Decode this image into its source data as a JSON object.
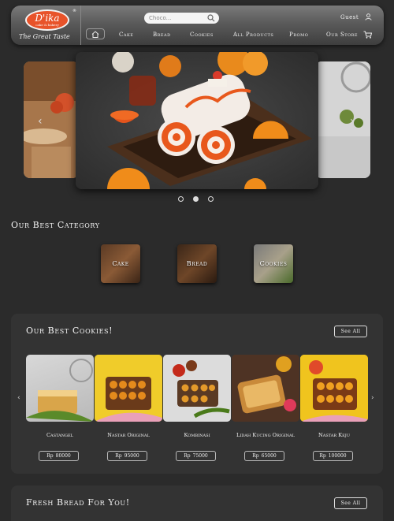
{
  "header": {
    "logo_main": "D'ika",
    "logo_sub": "cake & bakery",
    "logo_reg": "®",
    "logo_tagline": "The Great Taste",
    "search_placeholder": "Choco...",
    "guest_label": "Guest",
    "nav": [
      "Cake",
      "Bread",
      "Cookies",
      "All Products",
      "Promo",
      "Our Store"
    ]
  },
  "carousel": {
    "prev_arrow": "‹",
    "next_arrow": "›",
    "slide_count": 3,
    "active_slide": 2
  },
  "category": {
    "title": "Our Best Category",
    "items": [
      "Cake",
      "Bread",
      "Cookies"
    ]
  },
  "cookies": {
    "title": "Our Best Cookies!",
    "see_all": "See All",
    "items": [
      {
        "name": "Castangel",
        "currency": "Rp",
        "price": "80000"
      },
      {
        "name": "Nastar Original",
        "currency": "Rp",
        "price": "95000"
      },
      {
        "name": "Kombinasi",
        "currency": "Rp",
        "price": "75000"
      },
      {
        "name": "Lidah Kucing Original",
        "currency": "Rp",
        "price": "65000"
      },
      {
        "name": "Nastar Keju",
        "currency": "Rp",
        "price": "100000"
      }
    ]
  },
  "bread": {
    "title": "Fresh Bread For You!",
    "see_all": "See All"
  },
  "colors": {
    "background": "#2b2b2b",
    "panel": "#333333",
    "logo_orange": "#e8532a"
  }
}
